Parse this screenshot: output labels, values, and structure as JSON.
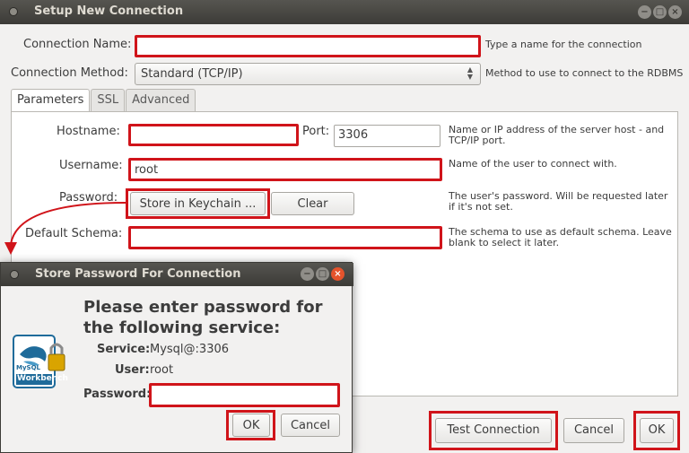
{
  "main_window": {
    "title": "Setup New Connection",
    "connection_name": {
      "label": "Connection Name:",
      "value": "",
      "help": "Type a name for the connection"
    },
    "connection_method": {
      "label": "Connection Method:",
      "value": "Standard (TCP/IP)",
      "help": "Method to use to connect to the RDBMS"
    },
    "tabs": [
      {
        "label": "Parameters",
        "active": true
      },
      {
        "label": "SSL",
        "active": false
      },
      {
        "label": "Advanced",
        "active": false
      }
    ],
    "hostname": {
      "label": "Hostname:",
      "value": "",
      "help_line1": "Name or IP address of the server host - and",
      "help_line2": "TCP/IP port."
    },
    "port": {
      "label": "Port:",
      "value": "3306"
    },
    "username": {
      "label": "Username:",
      "value": "root",
      "help": "Name of the user to connect with."
    },
    "password": {
      "label": "Password:",
      "store_button": "Store in Keychain ...",
      "clear_button": "Clear",
      "help_line1": "The user's password. Will be requested later",
      "help_line2": "if it's not set."
    },
    "default_schema": {
      "label": "Default Schema:",
      "value": "",
      "help_line1": "The schema to use as default schema. Leave",
      "help_line2": "blank to select it later."
    },
    "buttons": {
      "test_connection": "Test Connection",
      "cancel": "Cancel",
      "ok": "OK"
    }
  },
  "dialog": {
    "title": "Store Password For Connection",
    "heading": "Please enter password for the following service:",
    "service_label": "Service:",
    "service_value": "Mysql@:3306",
    "user_label": "User:",
    "user_value": "root",
    "password_label": "Password:",
    "password_value": "",
    "ok_button": "OK",
    "cancel_button": "Cancel",
    "logo_text_top": "MySQL",
    "logo_text_bottom": "Workbench"
  },
  "colors": {
    "highlight": "#d0141a",
    "titlebar": "#3c3b37",
    "background": "#f2f1f0",
    "close_button": "#e5532c"
  }
}
